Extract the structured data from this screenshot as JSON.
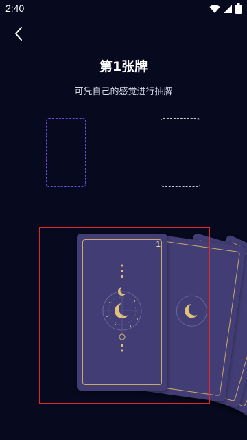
{
  "status": {
    "time": "2:40"
  },
  "header": {
    "title": "第1张牌",
    "subtitle": "可凭自己的感觉进行抽牌"
  },
  "deck": {
    "top_card_number": "1"
  },
  "colors": {
    "background": "#070a1e",
    "card": "#423e75",
    "gold": "#c9a96a",
    "slot_selected": "#6b4bd6",
    "highlight": "#e02828"
  }
}
